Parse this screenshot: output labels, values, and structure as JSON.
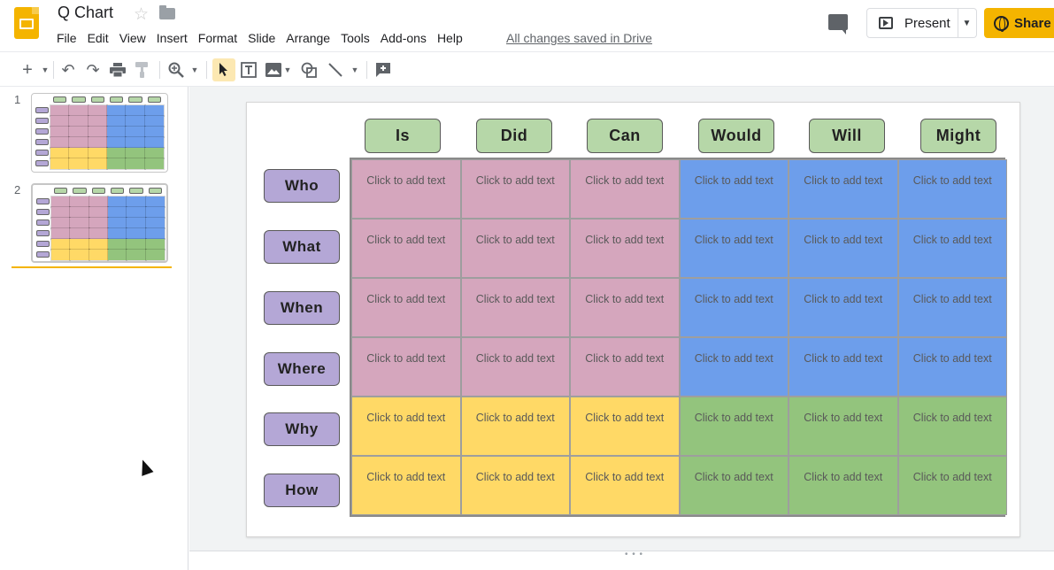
{
  "header": {
    "doc_title": "Q Chart",
    "saved_status": "All changes saved in Drive",
    "present_label": "Present",
    "share_label": "Share"
  },
  "menu": [
    "File",
    "Edit",
    "View",
    "Insert",
    "Format",
    "Slide",
    "Arrange",
    "Tools",
    "Add-ons",
    "Help"
  ],
  "toolbar": {
    "icons": [
      "new-slide-icon",
      "undo-icon",
      "redo-icon",
      "print-icon",
      "paint-format-icon",
      "zoom-icon",
      "select-icon",
      "text-box-icon",
      "image-icon",
      "shape-icon",
      "line-icon",
      "comment-add-icon"
    ]
  },
  "filmstrip": {
    "slides": [
      {
        "number": "1"
      },
      {
        "number": "2",
        "selected": true
      }
    ]
  },
  "slide": {
    "column_headers": [
      "Is",
      "Did",
      "Can",
      "Would",
      "Will",
      "Might"
    ],
    "row_headers": [
      "Who",
      "What",
      "When",
      "Where",
      "Why",
      "How"
    ],
    "placeholder": "Click to add text",
    "colors": {
      "pink": "#d5a6bd",
      "blue": "#6d9eeb",
      "yellow": "#ffd966",
      "green": "#93c47d",
      "column_header": "#b6d7a8",
      "row_header": "#b4a7d6"
    }
  }
}
